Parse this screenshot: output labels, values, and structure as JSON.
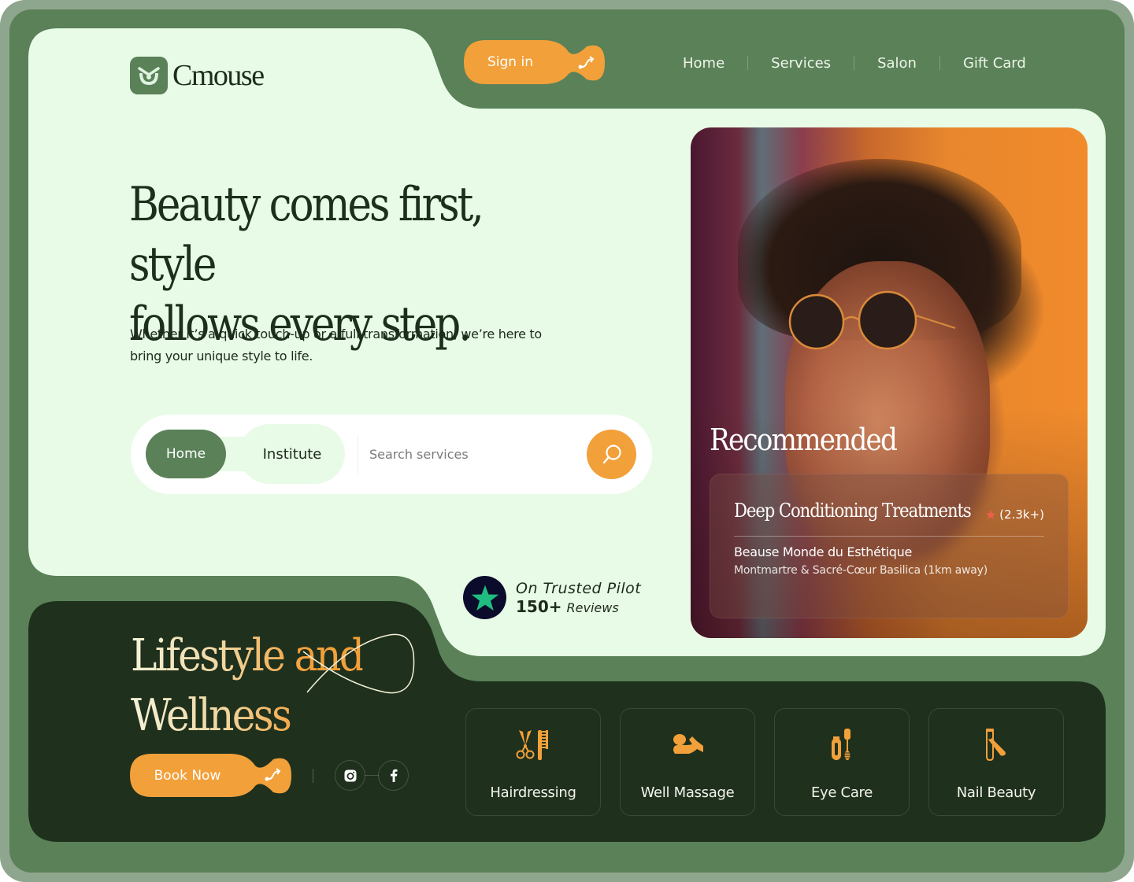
{
  "brand": {
    "name": "Cmouse"
  },
  "header": {
    "signin_label": "Sign in",
    "nav": [
      "Home",
      "Services",
      "Salon",
      "Gift Card"
    ]
  },
  "hero": {
    "headline_line1": "Beauty comes first, style",
    "headline_line2": "follows every step.",
    "subtext": "Whether it’s a quick touch-up or a full transformation, we’re here to bring your unique style to life."
  },
  "search": {
    "tabs": [
      "Home",
      "Institute"
    ],
    "active_tab": "Home",
    "placeholder": "Search services",
    "value": ""
  },
  "trust": {
    "line1": "On Trusted Pilot",
    "count": "150+",
    "reviews_label": "Reviews"
  },
  "recommended": {
    "heading": "Recommended",
    "title": "Deep Conditioning Treatments",
    "rating": "(2.3k+)",
    "salon": "Beause Monde du Esthétique",
    "location": "Montmartre & Sacré-Cœur Basilica (1km away)"
  },
  "lifestyle": {
    "title_line1": "Lifestyle and",
    "title_line2": "Wellness",
    "book_label": "Book Now",
    "socials": [
      "instagram-icon",
      "facebook-icon"
    ]
  },
  "services": [
    {
      "label": "Hairdressing",
      "icon": "scissors-comb-icon"
    },
    {
      "label": "Well Massage",
      "icon": "massage-icon"
    },
    {
      "label": "Eye Care",
      "icon": "mascara-icon"
    },
    {
      "label": "Nail Beauty",
      "icon": "nail-clipper-icon"
    }
  ],
  "colors": {
    "outer": "#8fa68e",
    "green": "#5a8158",
    "mint": "#e8fbe6",
    "dark": "#1f301d",
    "accent": "#f2a03a",
    "trustpilot_bg": "#0b0c2c",
    "trustpilot_star": "#1fbd7f"
  }
}
